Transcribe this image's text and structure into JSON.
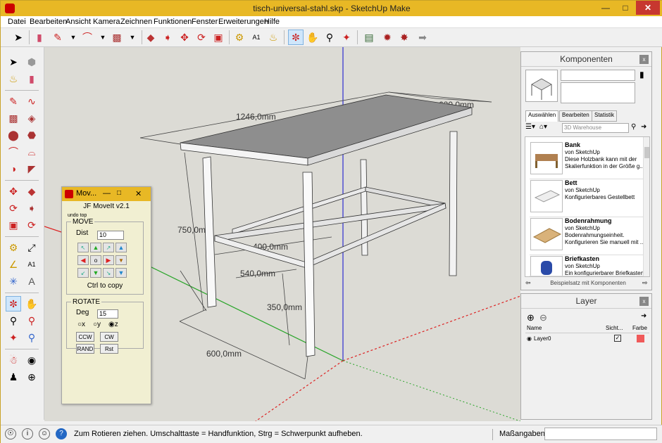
{
  "window": {
    "title": "tisch-universal-stahl.skp - SketchUp Make"
  },
  "menu": [
    "Datei",
    "Bearbeiten",
    "Ansicht",
    "Kamera",
    "Zeichnen",
    "Funktionen",
    "Fenster",
    "Erweiterungen",
    "Hilfe"
  ],
  "dims": {
    "length": "1246,0mm",
    "depth": "620,0mm",
    "height": "750,0mm",
    "inner_depth": "400,0mm",
    "inner_length": "540,0mm",
    "rail_height": "350,0mm",
    "width": "600,0mm"
  },
  "plugin": {
    "title": "Mov...",
    "name": "JF MoveIt v2.1",
    "undo": "undo top",
    "move_legend": "MOVE",
    "dist_label": "Dist",
    "dist_value": "10",
    "ctrl_copy": "Ctrl to copy",
    "rotate_legend": "ROTATE",
    "deg_label": "Deg",
    "deg_value": "15",
    "axis_x": "x",
    "axis_y": "y",
    "axis_z": "z",
    "ccw": "CCW",
    "cw": "CW",
    "rand": "RAND",
    "rst": "Rst"
  },
  "components": {
    "title": "Komponenten",
    "tabs": [
      "Auswählen",
      "Bearbeiten",
      "Statistik"
    ],
    "search_placeholder": "3D Warehouse",
    "items": [
      {
        "name": "Bank",
        "author": "von SketchUp",
        "desc": "Diese Holzbank kann mit der Skalierfunktion in der Größe g..."
      },
      {
        "name": "Bett",
        "author": "von SketchUp",
        "desc": "Konfigurierbares Gestellbett"
      },
      {
        "name": "Bodenrahmung",
        "author": "von SketchUp",
        "desc": "Bodenrahmungseinheit. Konfigurieren Sie manuell mit ..."
      },
      {
        "name": "Briefkasten",
        "author": "von SketchUp",
        "desc": "Ein konfigurierbarer Briefkasten"
      }
    ],
    "footer": "Beispielsatz mit Komponenten"
  },
  "layer": {
    "title": "Layer",
    "col_name": "Name",
    "col_visible": "Sicht...",
    "col_color": "Farbe",
    "rows": [
      {
        "name": "Layer0",
        "color": "#f05a5a"
      }
    ]
  },
  "status": {
    "message": "Zum Rotieren ziehen. Umschalttaste = Handfunktion, Strg = Schwerpunkt aufheben.",
    "measure_label": "Maßangaben"
  }
}
